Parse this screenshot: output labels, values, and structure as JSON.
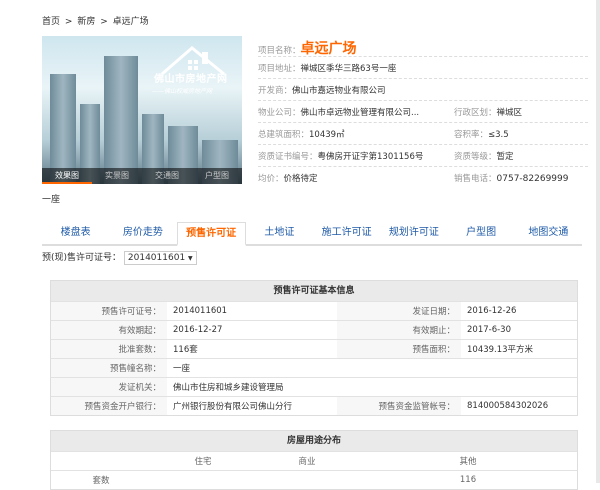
{
  "breadcrumb": [
    "首页",
    ">",
    "新房",
    ">",
    "卓远广场"
  ],
  "hero": {
    "logo_text": "佛山市房地产网",
    "logo_sub": "——佛山权威房地产网",
    "tabs": [
      "效果图",
      "实景图",
      "交通图",
      "户型图"
    ]
  },
  "info": {
    "name_label": "项目名称：",
    "name": "卓远广场",
    "address_label": "项目地址：",
    "address": "禅城区季华三路63号一座",
    "developer_label": "开发商：",
    "developer": "佛山市嘉远物业有限公司",
    "property_label": "物业公司：",
    "property": "佛山市卓远物业管理有限公司...",
    "district_label": "行政区划：",
    "district": "禅城区",
    "area_label": "总建筑面积：",
    "area": "10439㎡",
    "plot_label": "容积率：",
    "plot": "≤3.5",
    "cert_label": "资质证书编号：",
    "cert": "粤佛房开证字第1301156号",
    "level_label": "资质等级：",
    "level": "暂定",
    "price_label": "均价：",
    "price": "价格待定",
    "tel_label": "销售电话：",
    "tel": "0757-82269999"
  },
  "caption": "一座",
  "nav": [
    "楼盘表",
    "房价走势",
    "预售许可证",
    "土地证",
    "施工许可证",
    "规划许可证",
    "户型图",
    "地图交通"
  ],
  "permit_select": {
    "label": "预(现)售许可证号：",
    "value": "2014011601",
    "arrow": "▼"
  },
  "permit_info": {
    "title": "预售许可证基本信息",
    "rows": [
      {
        "l1": "预售许可证号：",
        "v1": "2014011601",
        "l2": "发证日期：",
        "v2": "2016-12-26"
      },
      {
        "l1": "有效期起：",
        "v1": "2016-12-27",
        "l2": "有效期止：",
        "v2": "2017-6-30"
      },
      {
        "l1": "批准套数：",
        "v1": "116套",
        "l2": "预售面积：",
        "v2": "10439.13平方米"
      },
      {
        "l1": "预售幢名称：",
        "v1": "一座",
        "l2": "",
        "v2": ""
      },
      {
        "l1": "发证机关：",
        "v1": "佛山市住房和城乡建设管理局",
        "l2": "",
        "v2": ""
      },
      {
        "l1": "预售资金开户银行：",
        "v1": "广州银行股份有限公司佛山分行",
        "l2": "预售资金监管帐号：",
        "v2": "814000584302026"
      }
    ]
  },
  "usage": {
    "title": "房屋用途分布",
    "headers": [
      "",
      "住宅",
      "商业",
      "其他"
    ],
    "row_label": "套数",
    "row_values": [
      "",
      "",
      "116"
    ]
  }
}
